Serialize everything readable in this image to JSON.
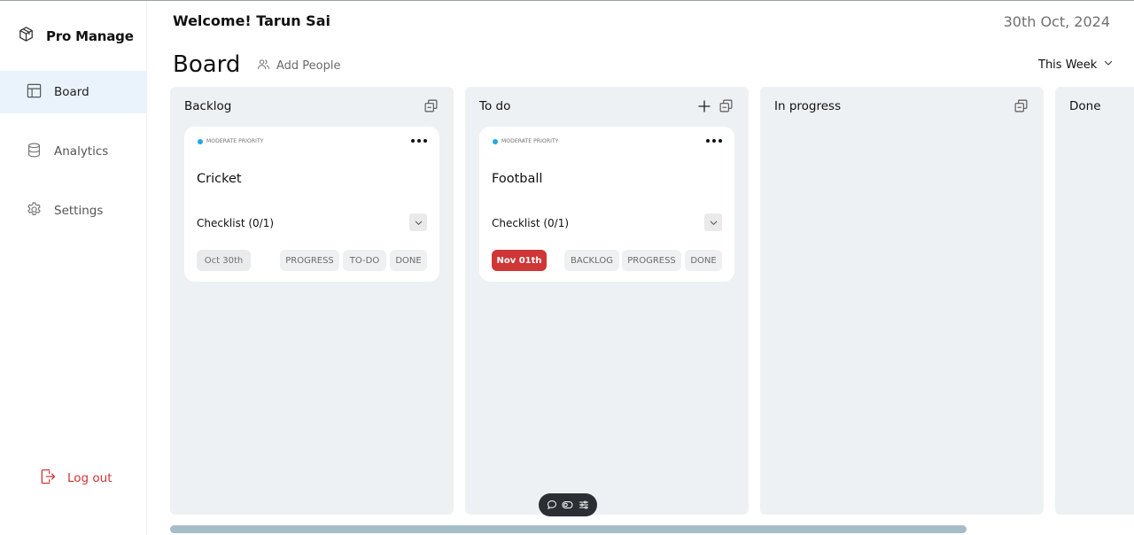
{
  "app": {
    "name": "Pro Manage"
  },
  "sidebar": {
    "items": [
      {
        "label": "Board",
        "icon": "board-layout-icon",
        "active": true
      },
      {
        "label": "Analytics",
        "icon": "database-icon",
        "active": false
      },
      {
        "label": "Settings",
        "icon": "gear-icon",
        "active": false
      }
    ],
    "logout_label": "Log out"
  },
  "header": {
    "welcome": "Welcome! Tarun Sai",
    "date": "30th Oct, 2024",
    "board_title": "Board",
    "add_people_label": "Add People",
    "filter_label": "This Week"
  },
  "columns": [
    {
      "title": "Backlog",
      "cards": [
        {
          "priority": "MODERATE PRIORITY",
          "title": "Cricket",
          "checklist": "Checklist (0/1)",
          "due": "Oct 30th",
          "moves": [
            "PROGRESS",
            "TO-DO",
            "DONE"
          ]
        }
      ]
    },
    {
      "title": "To do",
      "cards": [
        {
          "priority": "MODERATE PRIORITY",
          "title": "Football",
          "checklist": "Checklist (0/1)",
          "due": "Nov 01th",
          "moves": [
            "BACKLOG",
            "PROGRESS",
            "DONE"
          ]
        }
      ]
    },
    {
      "title": "In progress",
      "cards": []
    },
    {
      "title": "Done",
      "cards": []
    }
  ],
  "colors": {
    "priority_dot": "#1fa8ec",
    "overdue": "#cf3636",
    "column_bg": "#eef1f4",
    "active_nav": "#eaf2fc"
  }
}
